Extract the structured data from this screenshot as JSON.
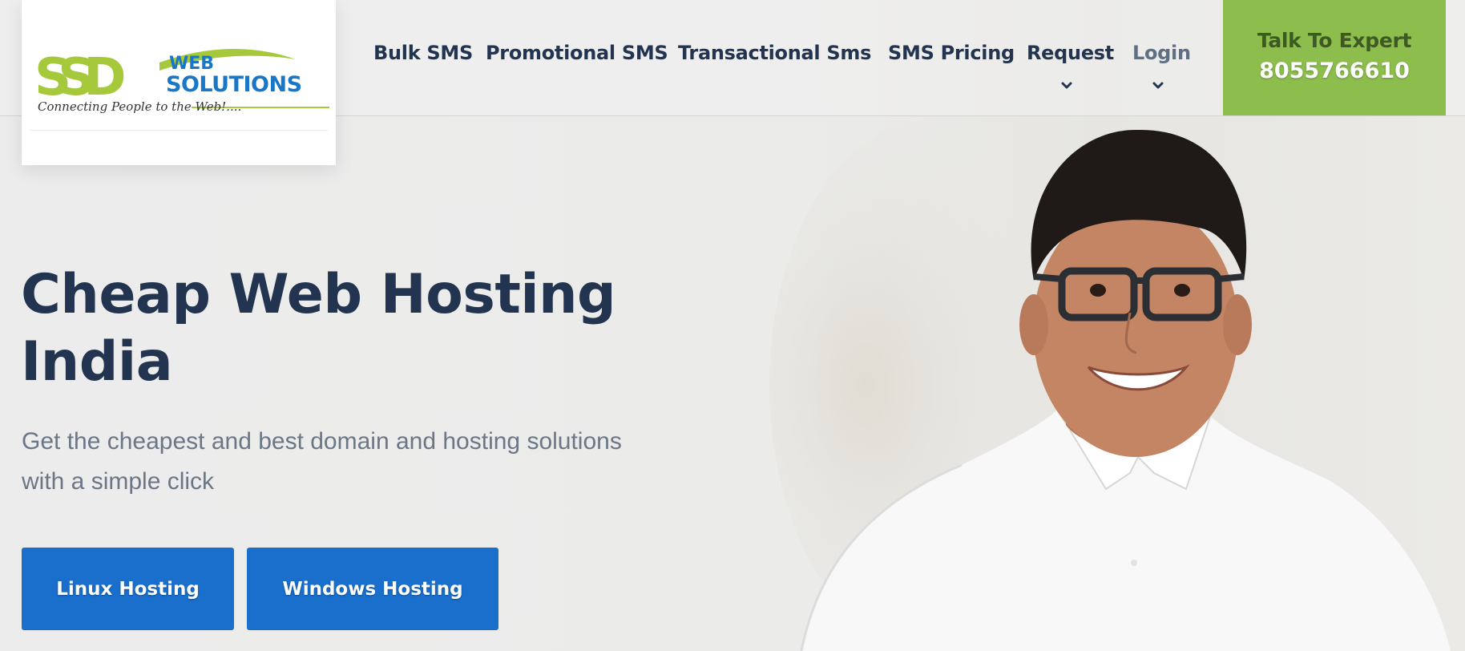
{
  "brand": {
    "logo_letters": "SSD",
    "logo_word1": "WEB",
    "logo_word2": "SOLUTIONS",
    "tagline": "Connecting People to the Web!....",
    "colors": {
      "green": "#a5c93b",
      "blue": "#1a76c7",
      "dark": "#2a2a2a"
    }
  },
  "nav": {
    "items": [
      {
        "label": "Bulk SMS",
        "dropdown": false
      },
      {
        "label": "Promotional SMS",
        "dropdown": false
      },
      {
        "label": "Transactional Sms",
        "dropdown": false
      },
      {
        "label": "SMS Pricing",
        "dropdown": false
      },
      {
        "label": "Request",
        "dropdown": true
      },
      {
        "label": "Login",
        "dropdown": true
      }
    ],
    "dropdown_icon": "chevron-down-icon"
  },
  "cta": {
    "label": "Talk To Expert",
    "phone": "8055766610",
    "color": "#8cbd4d"
  },
  "hero": {
    "title_line1": "Cheap Web Hosting",
    "title_line2": "India",
    "subtitle_line1": "Get the cheapest and best domain and hosting solutions",
    "subtitle_line2": "with a simple click",
    "buttons": [
      {
        "label": "Linux Hosting"
      },
      {
        "label": "Windows Hosting"
      }
    ],
    "button_color": "#1a6fcc",
    "image": "smiling-man-with-glasses-photo"
  }
}
